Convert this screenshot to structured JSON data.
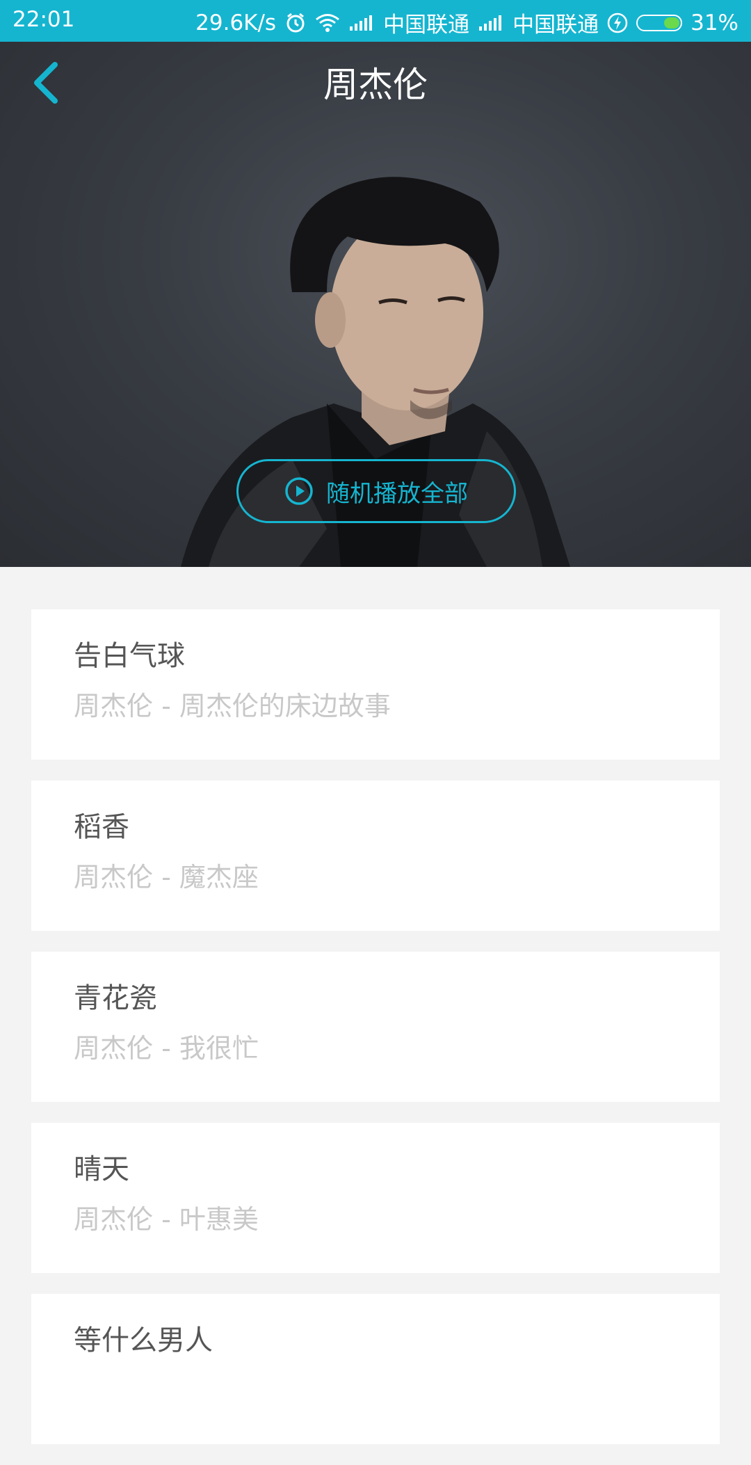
{
  "status_bar": {
    "time": "22:01",
    "network_speed": "29.6K/s",
    "carrier1": "中国联通",
    "carrier2": "中国联通",
    "battery_percent": "31%",
    "battery_level": 0.31,
    "icons": [
      "alarm-icon",
      "wifi-icon",
      "signal-icon",
      "signal-icon",
      "charging-icon",
      "battery-icon"
    ]
  },
  "header": {
    "title": "周杰伦",
    "back_icon": "chevron-left-icon"
  },
  "hero": {
    "play_all_label": "随机播放全部",
    "play_icon": "play-circle-icon"
  },
  "songs": [
    {
      "title": "告白气球",
      "subtitle": "周杰伦 - 周杰伦的床边故事"
    },
    {
      "title": "稻香",
      "subtitle": "周杰伦 - 魔杰座"
    },
    {
      "title": "青花瓷",
      "subtitle": "周杰伦 - 我很忙"
    },
    {
      "title": "晴天",
      "subtitle": "周杰伦 - 叶惠美"
    },
    {
      "title": "等什么男人",
      "subtitle": ""
    }
  ],
  "colors": {
    "accent": "#15b5d0",
    "background": "#f3f3f3",
    "card": "#ffffff",
    "title_text": "#555555",
    "subtitle_text": "#c8c8c8"
  }
}
